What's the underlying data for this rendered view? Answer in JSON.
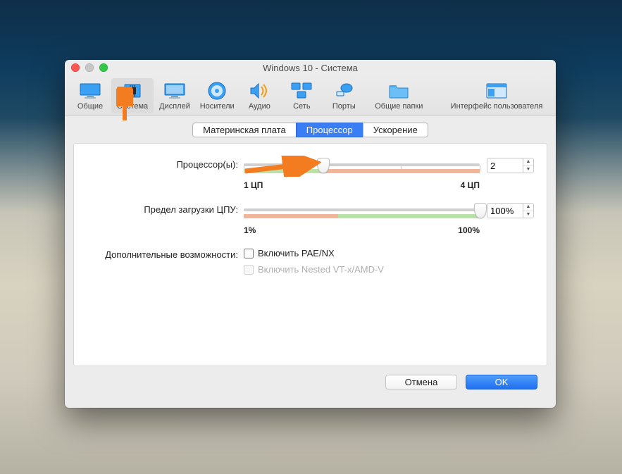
{
  "window": {
    "title": "Windows 10 - Система"
  },
  "toolbar": {
    "general": "Общие",
    "system": "Система",
    "display": "Дисплей",
    "storage": "Носители",
    "audio": "Аудио",
    "network": "Сеть",
    "ports": "Порты",
    "shared": "Общие папки",
    "ui": "Интерфейс пользователя"
  },
  "tabs": {
    "motherboard": "Материнская плата",
    "processor": "Процессор",
    "acceleration": "Ускорение"
  },
  "labels": {
    "processors": "Процессор(ы):",
    "execution_cap": "Предел загрузки ЦПУ:",
    "extra": "Дополнительные возможности:"
  },
  "cpu": {
    "min_label": "1 ЦП",
    "max_label": "4 ЦП",
    "value": "2"
  },
  "cap": {
    "min_label": "1%",
    "max_label": "100%",
    "value": "100%"
  },
  "checks": {
    "pae": "Включить PAE/NX",
    "nested": "Включить Nested VT-x/AMD-V"
  },
  "buttons": {
    "cancel": "Отмена",
    "ok": "OK"
  }
}
